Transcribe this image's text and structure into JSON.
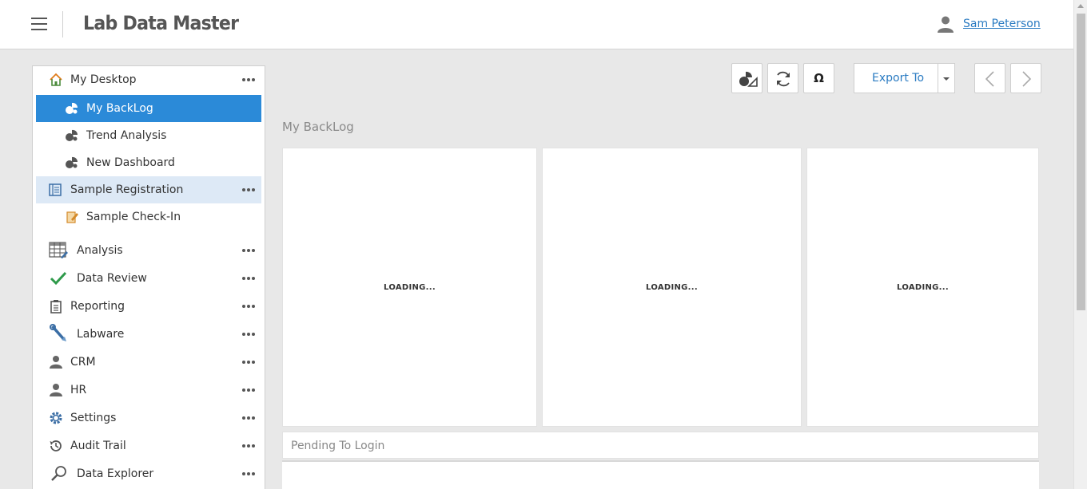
{
  "header": {
    "app_title": "Lab Data Master",
    "user_name": "Sam Peterson"
  },
  "sidebar": {
    "items": [
      {
        "label": "My Desktop",
        "icon": "home-icon",
        "has_menu": true
      },
      {
        "label": "My BackLog",
        "icon": "dashboard-icon",
        "active": true
      },
      {
        "label": "Trend Analysis",
        "icon": "dashboard-icon"
      },
      {
        "label": "New Dashboard",
        "icon": "dashboard-icon"
      },
      {
        "label": "Sample Registration",
        "icon": "registration-icon",
        "has_menu": true,
        "highlighted": true
      },
      {
        "label": "Sample Check-In",
        "icon": "checkin-icon"
      },
      {
        "label": "Analysis",
        "icon": "spreadsheet-icon",
        "has_menu": true
      },
      {
        "label": "Data Review",
        "icon": "checkmark-icon",
        "has_menu": true
      },
      {
        "label": "Reporting",
        "icon": "clipboard-icon",
        "has_menu": true
      },
      {
        "label": "Labware",
        "icon": "wrench-icon",
        "has_menu": true
      },
      {
        "label": "CRM",
        "icon": "person-icon",
        "has_menu": true
      },
      {
        "label": "HR",
        "icon": "person-icon",
        "has_menu": true
      },
      {
        "label": "Settings",
        "icon": "gear-icon",
        "has_menu": true
      },
      {
        "label": "Audit Trail",
        "icon": "history-icon",
        "has_menu": true
      },
      {
        "label": "Data Explorer",
        "icon": "search-icon",
        "has_menu": true
      }
    ]
  },
  "toolbar": {
    "chart_button_icon": "chart-shapes-icon",
    "refresh_button_icon": "refresh-icon",
    "omega_label": "Ω",
    "export_label": "Export To"
  },
  "main": {
    "section_title": "My BackLog",
    "panels": [
      {
        "status": "LOADING..."
      },
      {
        "status": "LOADING..."
      },
      {
        "status": "LOADING..."
      }
    ],
    "pending_title": "Pending To Login"
  },
  "colors": {
    "active_bg": "#2b8ad8",
    "highlight_bg": "#dde9f6",
    "link": "#2a7bc2"
  }
}
